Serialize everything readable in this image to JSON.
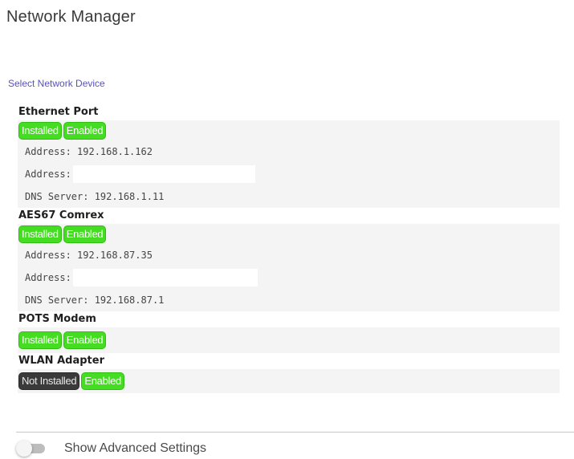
{
  "page": {
    "title": "Network Manager"
  },
  "section": {
    "label": "Select Network Device"
  },
  "devices": [
    {
      "name": "Ethernet Port",
      "status_installed": "Installed",
      "status_enabled": "Enabled",
      "address_line": "Address: 192.168.1.162",
      "address_label": "Address:",
      "address_value": "",
      "dns_line": "DNS Server: 192.168.1.11"
    },
    {
      "name": "AES67 Comrex",
      "status_installed": "Installed",
      "status_enabled": "Enabled",
      "address_line": "Address: 192.168.87.35",
      "address_label": "Address:",
      "address_value": "",
      "dns_line": "DNS Server: 192.168.87.1"
    },
    {
      "name": "POTS Modem",
      "status_installed": "Installed",
      "status_enabled": "Enabled"
    },
    {
      "name": "WLAN Adapter",
      "status_installed": "Not Installed",
      "status_enabled": "Enabled"
    }
  ],
  "advanced": {
    "label": "Show Advanced Settings",
    "checked": false
  },
  "colors": {
    "badge_ok": "#44dd22",
    "badge_off": "#3a3a3a",
    "section_label": "#5a52b8"
  }
}
